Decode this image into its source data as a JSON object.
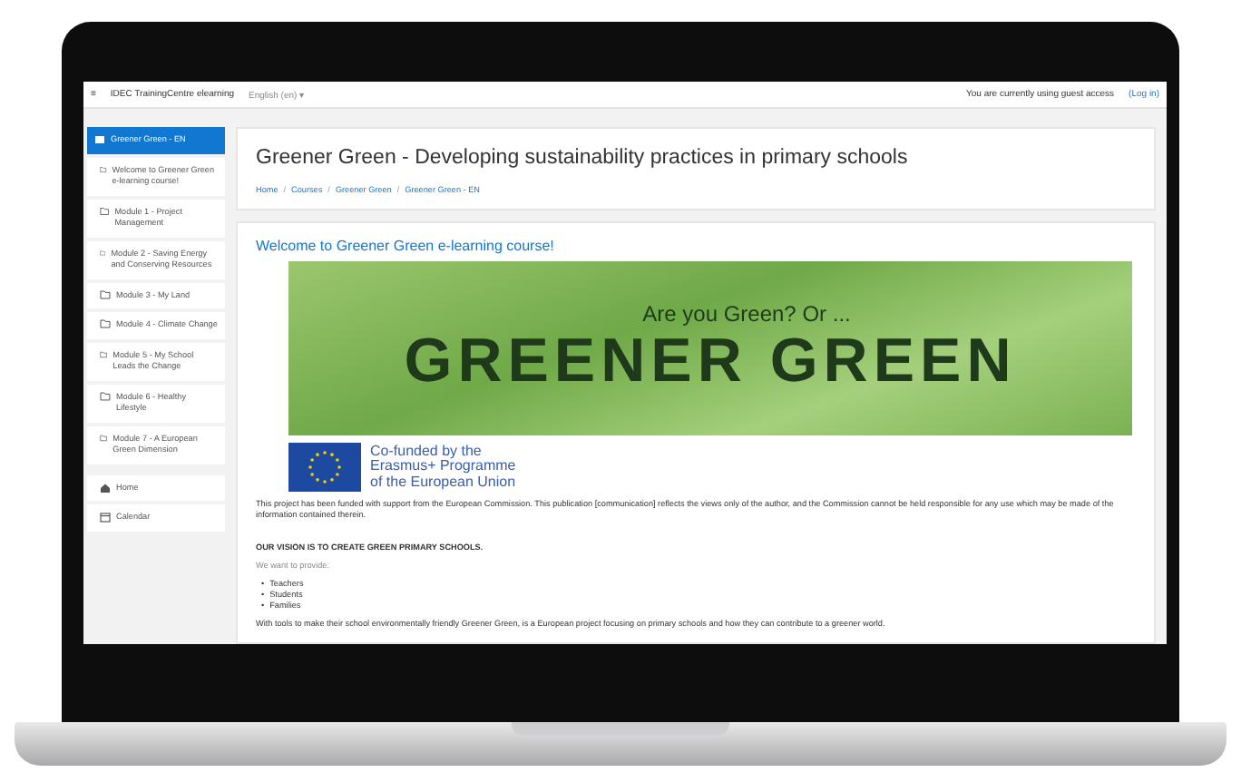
{
  "navbar": {
    "menu_icon": "≡",
    "site_name": "IDEC TrainingCentre elearning",
    "language": "English (en) ▾",
    "guest_notice": "You are currently using guest access",
    "login_link": "(Log in)"
  },
  "sidebar": {
    "items": [
      {
        "label": "Greener Green - EN",
        "kind": "course",
        "selected": true
      },
      {
        "label": "Welcome to Greener Green e-learning course!",
        "kind": "section",
        "selected": false
      },
      {
        "label": "Module 1 - Project Management",
        "kind": "section",
        "selected": false
      },
      {
        "label": "Module 2 - Saving Energy and Conserving Resources",
        "kind": "section",
        "selected": false
      },
      {
        "label": "Module 3 - My Land",
        "kind": "section",
        "selected": false
      },
      {
        "label": "Module 4 - Climate Change",
        "kind": "section",
        "selected": false
      },
      {
        "label": "Module 5 - My School Leads the Change",
        "kind": "section",
        "selected": false
      },
      {
        "label": "Module 6 - Healthy Lifestyle",
        "kind": "section",
        "selected": false
      },
      {
        "label": "Module 7 - A European Green Dimension",
        "kind": "section",
        "selected": false
      }
    ],
    "extra_items": [
      {
        "label": "Home",
        "kind": "home"
      },
      {
        "label": "Calendar",
        "kind": "calendar"
      }
    ]
  },
  "header": {
    "title": "Greener Green - Developing sustainability practices in primary schools",
    "breadcrumb": [
      "Home",
      "Courses",
      "Greener Green",
      "Greener Green - EN"
    ],
    "breadcrumb_separator": "/"
  },
  "content": {
    "welcome_link": "Welcome to Greener Green e-learning course!",
    "banner": {
      "subtitle": "Are you Green? Or ...",
      "title": "GREENER GREEN"
    },
    "eu_logo_text": [
      "Co-funded by the",
      "Erasmus+ Programme",
      "of the European Union"
    ],
    "disclaimer": "This project has been funded with support from the European Commission. This publication [communication] reflects the views only of the author, and the Commission cannot be held responsible for any use which may be made of the information contained therein.",
    "vision_heading": "OUR VISION IS TO CREATE GREEN PRIMARY SCHOOLS.",
    "intro": "We want to provide:",
    "list": [
      "Teachers",
      "Students",
      "Families"
    ],
    "list_marker": "•",
    "closing": "With tools to make their school environmentally friendly Greener Green, is a European project focusing on primary schools and how they can contribute to a greener world."
  }
}
